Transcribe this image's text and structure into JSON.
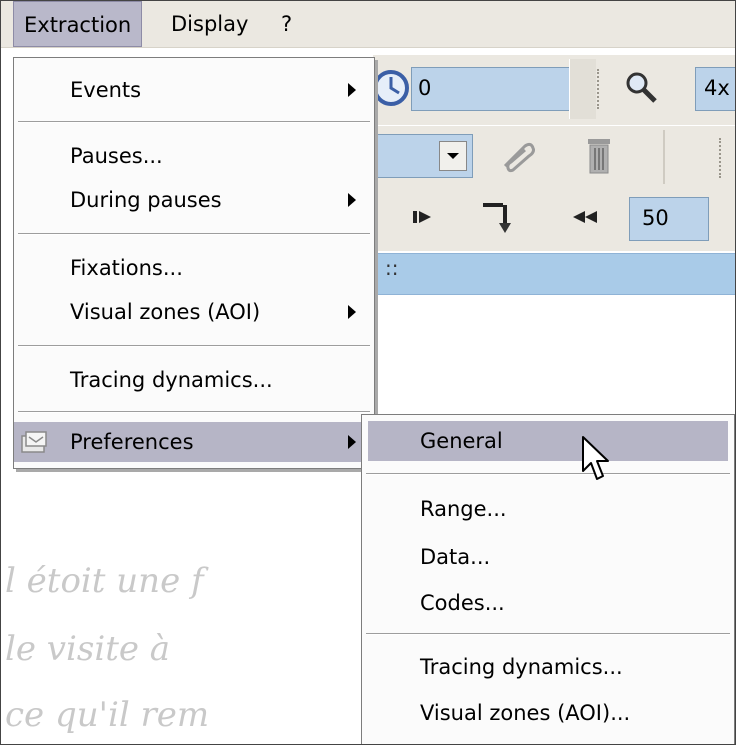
{
  "menubar": {
    "items": [
      "Extraction",
      "Display",
      "?"
    ]
  },
  "toolbar": {
    "field1_value": "0",
    "zoom_label": "4x",
    "speed_value": "50",
    "bar_marks": "::"
  },
  "extraction_menu": {
    "events": "Events",
    "pauses": "Pauses...",
    "during_pauses": "During pauses",
    "fixations": "Fixations...",
    "visual_zones": "Visual zones (AOI)",
    "tracing_dynamics": "Tracing dynamics...",
    "preferences": "Preferences"
  },
  "preferences_submenu": {
    "general": "General",
    "range": "Range...",
    "data": "Data...",
    "codes": "Codes...",
    "tracing_dynamics": "Tracing dynamics...",
    "visual_zones": "Visual zones (AOI)..."
  },
  "background_text": [
    "l  étoit  une  f",
    "le  visite  à",
    "ce  qu'il  rem"
  ],
  "colors": {
    "menubar": "#ebe8e1",
    "menu_highlight": "#b6b5c6",
    "field_blue": "#bcd3ea"
  }
}
